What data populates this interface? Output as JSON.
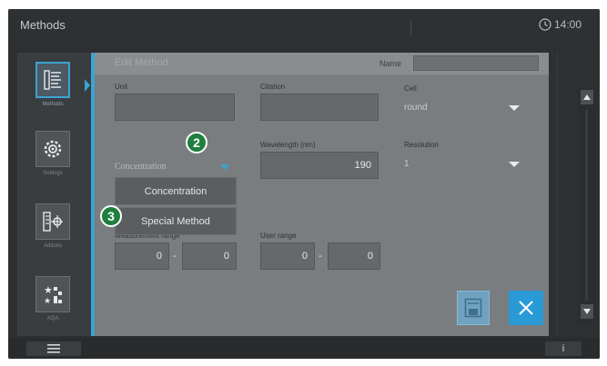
{
  "topbar": {
    "title": "Methods",
    "clock": "14:00"
  },
  "sidebar": {
    "items": [
      {
        "label": "Methods",
        "icon": "methods-list-icon",
        "active": true
      },
      {
        "label": "Settings",
        "icon": "settings-gear-icon",
        "active": false
      },
      {
        "label": "Addons",
        "icon": "addons-icon",
        "active": false
      },
      {
        "label": "AQA",
        "icon": "aqa-icon",
        "active": false
      }
    ]
  },
  "dialog": {
    "title": "Edit Method",
    "name_label": "Name",
    "name_value": "",
    "unit_label": "Unit",
    "unit_value": "",
    "citation_label": "Citation",
    "citation_value": "",
    "cell_label": "Cell",
    "cell_value": "round",
    "mode_value": "Concentration",
    "wavelength_label": "Wavelength (nm)",
    "wavelength_value": "190",
    "resolution_label": "Resolution",
    "resolution_value": "1",
    "measurement_range_label": "Measurement range",
    "measurement_range_min": "0",
    "measurement_range_max": "0",
    "user_range_label": "User range",
    "user_range_min": "0",
    "user_range_max": "0",
    "dash": "-"
  },
  "dropdown": {
    "options": [
      "Concentration",
      "Special Method"
    ]
  },
  "badges": {
    "step_mode": "2",
    "step_special": "3"
  },
  "bottombar": {
    "info_label": "i"
  },
  "colors": {
    "accent": "#3ca3d3",
    "badge": "#1f7f3f",
    "close_button": "#2a9ad6"
  }
}
